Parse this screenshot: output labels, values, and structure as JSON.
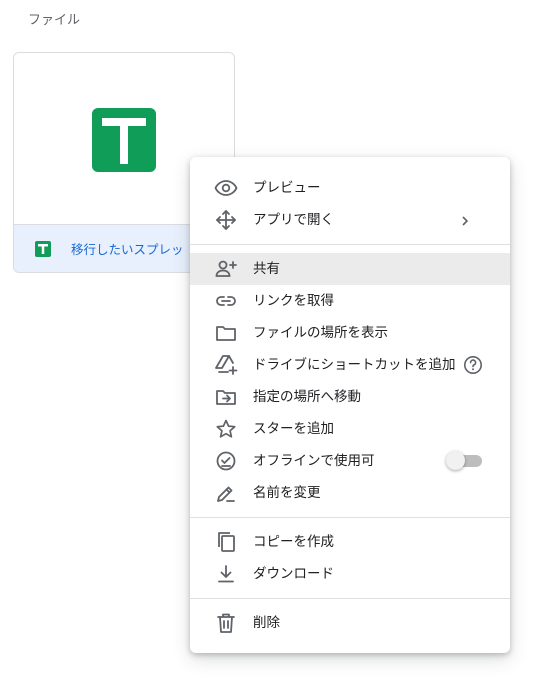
{
  "section": {
    "title": "ファイル"
  },
  "file": {
    "name": "移行したいスプレッ",
    "type_icon": "google-sheets-icon",
    "brand_color": "#0f9d58"
  },
  "menu": {
    "preview": {
      "label": "プレビュー",
      "icon": "eye-icon"
    },
    "open_with": {
      "label": "アプリで開く",
      "icon": "move-icon",
      "has_submenu": true
    },
    "share": {
      "label": "共有",
      "icon": "person-add-icon",
      "highlighted": true
    },
    "get_link": {
      "label": "リンクを取得",
      "icon": "link-icon"
    },
    "show_location": {
      "label": "ファイルの場所を表示",
      "icon": "folder-icon"
    },
    "add_shortcut": {
      "label": "ドライブにショートカットを追加",
      "icon": "drive-shortcut-icon",
      "help_icon": "help-icon"
    },
    "move_to": {
      "label": "指定の場所へ移動",
      "icon": "folder-move-icon"
    },
    "add_star": {
      "label": "スターを追加",
      "icon": "star-icon"
    },
    "offline": {
      "label": "オフラインで使用可",
      "icon": "offline-check-icon",
      "toggle_on": false
    },
    "rename": {
      "label": "名前を変更",
      "icon": "pencil-icon"
    },
    "make_copy": {
      "label": "コピーを作成",
      "icon": "copy-icon"
    },
    "download": {
      "label": "ダウンロード",
      "icon": "download-icon"
    },
    "remove": {
      "label": "削除",
      "icon": "trash-icon"
    }
  }
}
